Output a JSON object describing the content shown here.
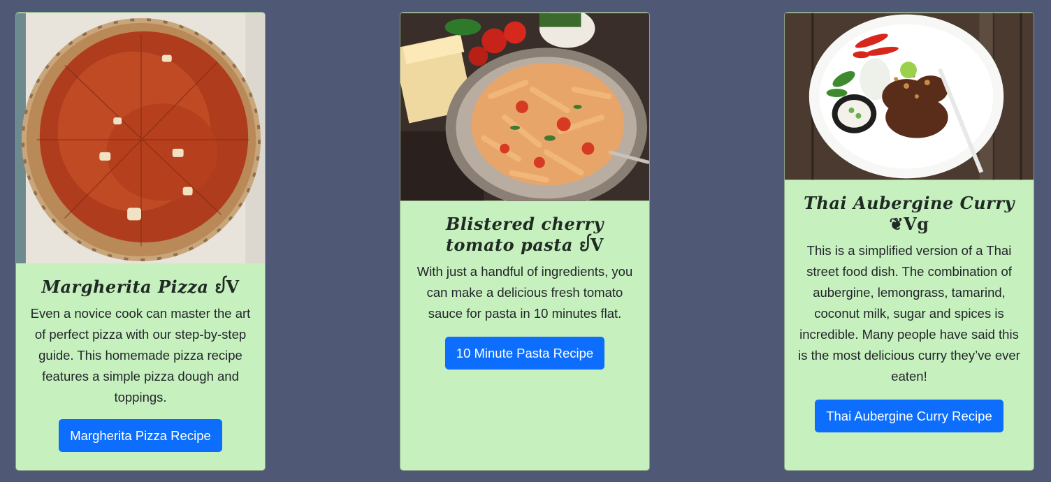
{
  "colors": {
    "page_background": "#4f5874",
    "card_background": "#c7f0bf",
    "button_background": "#0d6efd",
    "button_text": "#ffffff"
  },
  "cards": [
    {
      "image_alt": "Margherita pizza",
      "image_icon": "pizza-photo",
      "title": "Margherita Pizza",
      "diet_badge": "ᩀV",
      "description": "Even a novice cook can master the art of perfect pizza with our step-by-step guide. This homemade pizza recipe features a simple pizza dough and toppings.",
      "button_label": "Margherita Pizza Recipe"
    },
    {
      "image_alt": "Blistered cherry tomato pasta",
      "image_icon": "pasta-photo",
      "title": "Blistered cherry tomato pasta",
      "diet_badge": "ᩀV",
      "description": "With just a handful of ingredients, you can make a delicious fresh tomato sauce for pasta in 10 minutes flat.",
      "button_label": "10 Minute Pasta Recipe"
    },
    {
      "image_alt": "Thai aubergine curry",
      "image_icon": "curry-photo",
      "title": "Thai Aubergine Curry",
      "diet_badge": "❦Vg",
      "description": "This is a simplified version of a Thai street food dish. The combination of aubergine, lemongrass, tamarind, coconut milk, sugar and spices is incredible. Many people have said this is the most delicious curry they’ve ever eaten!",
      "button_label": "Thai Aubergine Curry Recipe"
    }
  ]
}
